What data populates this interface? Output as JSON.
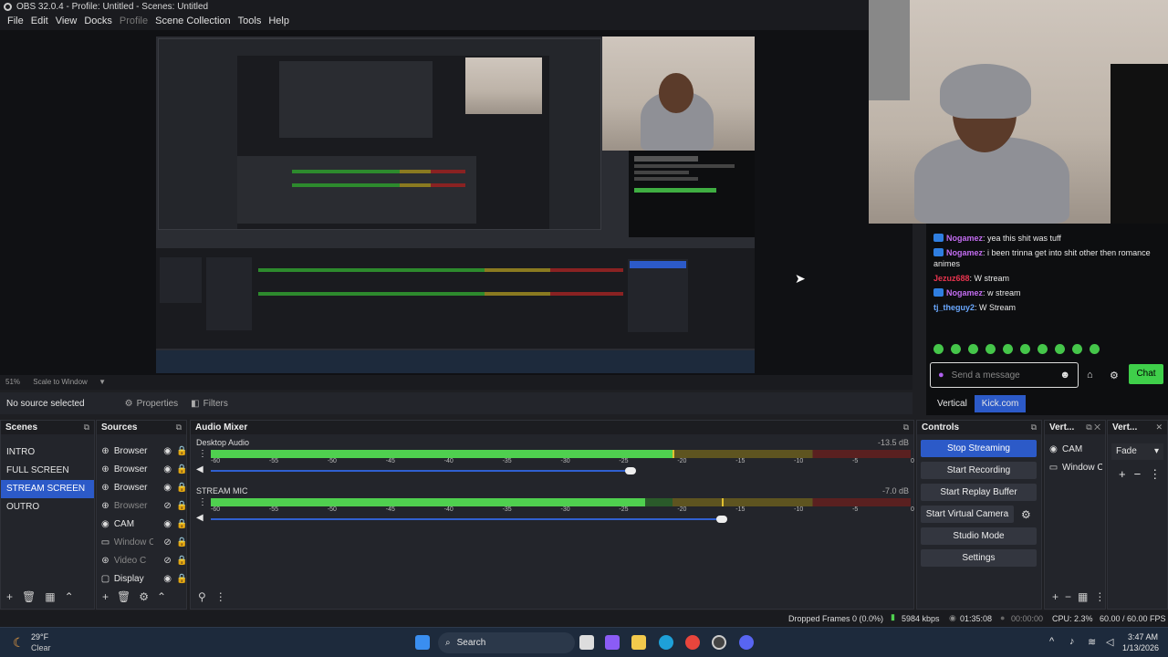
{
  "window": {
    "title": "OBS 32.0.4 - Profile: Untitled - Scenes: Untitled"
  },
  "menu": [
    {
      "label": "File",
      "enabled": true
    },
    {
      "label": "Edit",
      "enabled": true
    },
    {
      "label": "View",
      "enabled": true
    },
    {
      "label": "Docks",
      "enabled": true
    },
    {
      "label": "Profile",
      "enabled": false
    },
    {
      "label": "Scene Collection",
      "enabled": true
    },
    {
      "label": "Tools",
      "enabled": true
    },
    {
      "label": "Help",
      "enabled": true
    }
  ],
  "preview": {
    "zoom": "51%",
    "scale_mode": "Scale to Window",
    "no_source": "No source selected",
    "properties": "Properties",
    "filters": "Filters"
  },
  "scenes": {
    "title": "Scenes",
    "items": [
      "INTRO",
      "FULL SCREEN",
      "STREAM SCREEN",
      "OUTRO"
    ],
    "selected": "STREAM SCREEN"
  },
  "sources": {
    "title": "Sources",
    "items": [
      {
        "name": "Browser",
        "icon": "globe-icon",
        "visible": true
      },
      {
        "name": "Browser",
        "icon": "globe-icon",
        "visible": true
      },
      {
        "name": "Browser",
        "icon": "globe-icon",
        "visible": true
      },
      {
        "name": "Browser",
        "icon": "globe-icon",
        "visible": false
      },
      {
        "name": "CAM",
        "icon": "camera-icon",
        "visible": true
      },
      {
        "name": "Window C",
        "icon": "window-icon",
        "visible": false
      },
      {
        "name": "Video C",
        "icon": "video-icon",
        "visible": false
      },
      {
        "name": "Display",
        "icon": "monitor-icon",
        "visible": true
      }
    ]
  },
  "mixer": {
    "title": "Audio Mixer",
    "ticks": [
      "-60",
      "-55",
      "-50",
      "-45",
      "-40",
      "-35",
      "-30",
      "-25",
      "-20",
      "-15",
      "-10",
      "-5",
      "0"
    ],
    "channels": [
      {
        "name": "Desktop Audio",
        "db": "-13.5 dB",
        "level": 0.66,
        "peak": 0.66,
        "volume": 0.6
      },
      {
        "name": "STREAM MIC",
        "db": "-7.0 dB",
        "level": 0.62,
        "peak": 0.73,
        "volume": 0.73
      }
    ]
  },
  "controls": {
    "title": "Controls",
    "buttons": [
      "Stop Streaming",
      "Start Recording",
      "Start Replay Buffer",
      "Start Virtual Camera",
      "Studio Mode",
      "Settings"
    ]
  },
  "vertical_sources": {
    "title": "Vert...",
    "items": [
      "CAM",
      "Window C"
    ]
  },
  "vertical_transition": {
    "title": "Vert...",
    "value": "Fade"
  },
  "chat": {
    "messages": [
      {
        "user": "Nogamez",
        "text": ": yea this shit was tuff",
        "color": "#c26cf0",
        "badge": true
      },
      {
        "user": "Nogamez",
        "text": ": i been trinna get into shit other then romance animes",
        "color": "#c26cf0",
        "badge": true
      },
      {
        "user": "Jezuz688",
        "text": ": W stream",
        "color": "#e8344e",
        "badge": false
      },
      {
        "user": "Nogamez",
        "text": ": w stream",
        "color": "#c26cf0",
        "badge": true
      },
      {
        "user": "tj_theguy2",
        "text": ": W Stream",
        "color": "#6aa8ff",
        "badge": false
      }
    ],
    "placeholder": "Send a message",
    "send": "Chat",
    "tabs": [
      "Vertical",
      "Kick.com"
    ],
    "active_tab": "Kick.com"
  },
  "status": {
    "dropped": "Dropped Frames 0 (0.0%)",
    "bitrate": "5984 kbps",
    "live_time": "01:35:08",
    "rec_time": "00:00:00",
    "cpu": "CPU: 2.3%",
    "fps": "60.00 / 60.00 FPS"
  },
  "taskbar": {
    "weather_temp": "29°F",
    "weather_desc": "Clear",
    "search": "Search",
    "time": "3:47 AM",
    "date": "1/13/2026"
  }
}
